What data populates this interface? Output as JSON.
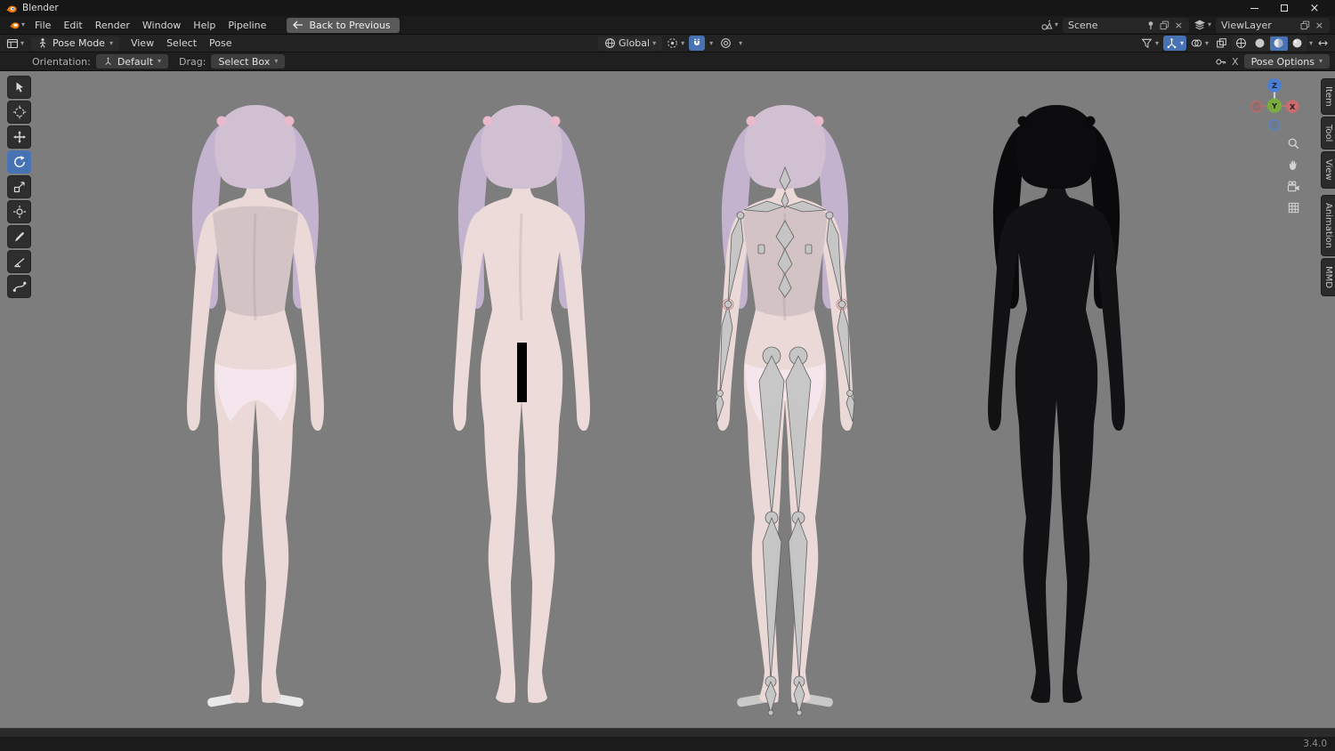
{
  "window": {
    "title": "Blender"
  },
  "topbar": {
    "menus": [
      "File",
      "Edit",
      "Render",
      "Window",
      "Help",
      "Pipeline"
    ],
    "back_button": "Back to Previous",
    "scene": {
      "label": "Scene"
    },
    "viewlayer": {
      "label": "ViewLayer"
    }
  },
  "viewport_header": {
    "mode": "Pose Mode",
    "menus": [
      "View",
      "Select",
      "Pose"
    ],
    "orientation": "Global"
  },
  "tool_settings": {
    "orientation_label": "Orientation:",
    "orientation_value": "Default",
    "drag_label": "Drag:",
    "drag_value": "Select Box",
    "clear_label": "X",
    "pose_options": "Pose Options"
  },
  "toolbar": {
    "tools": [
      "select-box",
      "cursor-3d",
      "move",
      "rotate",
      "scale",
      "transform",
      "annotate",
      "measure",
      "pose-breakdowner"
    ],
    "active_tool": "rotate"
  },
  "gizmo": {
    "z": "Z",
    "y": "Y",
    "x": "X"
  },
  "side_tabs": [
    "Item",
    "Tool",
    "View",
    "Animation",
    "MMD"
  ],
  "status": {
    "version": "3.4.0"
  },
  "viewport": {
    "figures": [
      "character-textured",
      "character-textured-censored",
      "character-armature-overlay",
      "character-wireframe"
    ]
  },
  "colors": {
    "accent_blue": "#4772b3",
    "viewport_bg": "#7d7d7d",
    "hair": "#c6b7d2",
    "skin": "#e9d7d4",
    "underwear": "#f3e4ea",
    "bone": "#c3c3c3",
    "wireframe": "#0e0e10"
  }
}
